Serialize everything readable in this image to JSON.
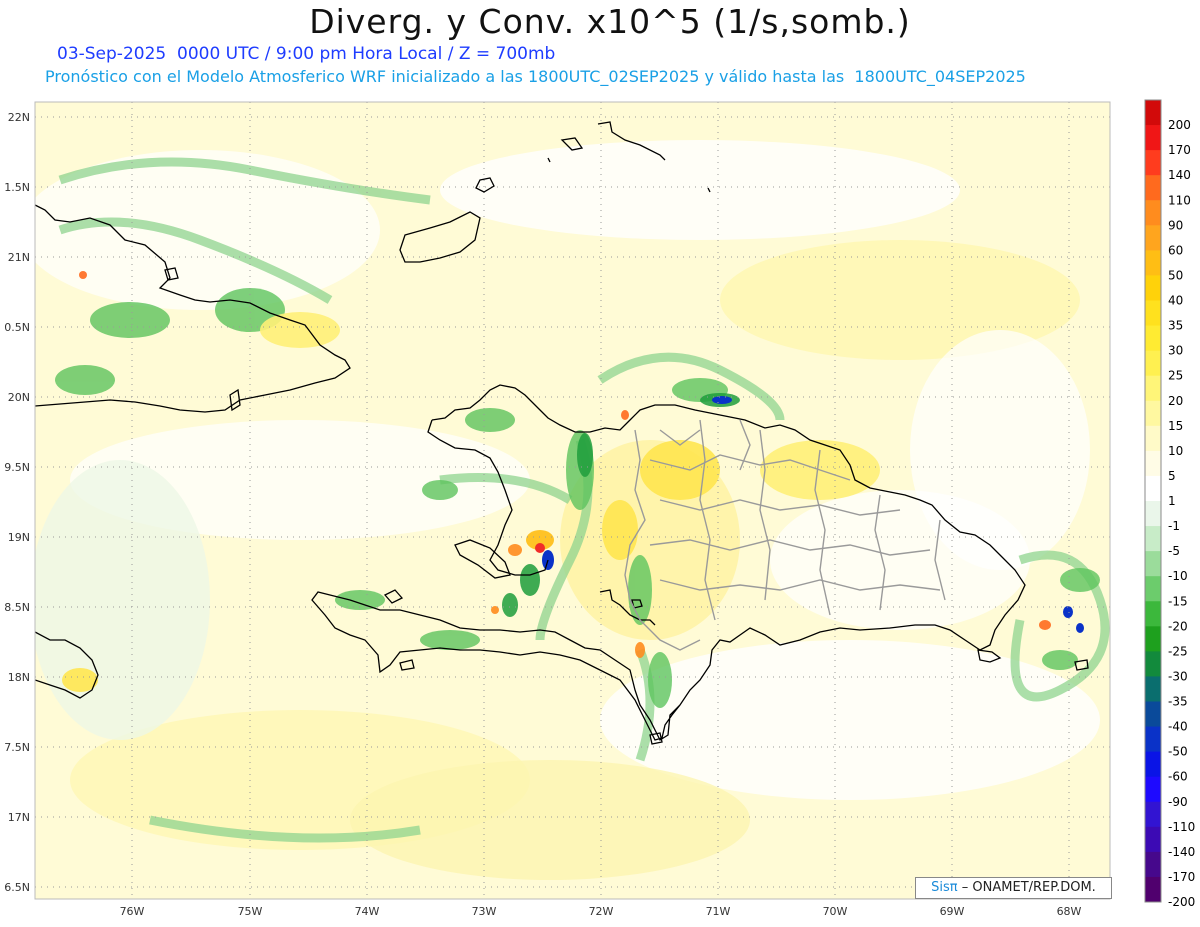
{
  "header": {
    "title": "Diverg. y Conv. x10^5 (1/s,somb.)",
    "subtitle_date": "03-Sep-2025  0000 UTC / 9:00 pm Hora Local / Z = 700mb",
    "subtitle_model": "Pronóstico con el Modelo Atmosferico WRF inicializado a las 1800UTC_02SEP2025 y válido hasta las  1800UTC_04SEP2025"
  },
  "axes": {
    "lat_labels": [
      "22N",
      "1.5N",
      "21N",
      "0.5N",
      "20N",
      "9.5N",
      "19N",
      "8.5N",
      "18N",
      "7.5N",
      "17N",
      "6.5N"
    ],
    "lon_labels": [
      "76W",
      "75W",
      "74W",
      "73W",
      "72W",
      "71W",
      "70W",
      "69W",
      "68W"
    ]
  },
  "colorbar": {
    "labels": [
      "200",
      "170",
      "140",
      "110",
      "90",
      "60",
      "50",
      "40",
      "35",
      "30",
      "25",
      "20",
      "15",
      "10",
      "5",
      "1",
      "-1",
      "-5",
      "-10",
      "-15",
      "-20",
      "-25",
      "-30",
      "-35",
      "-40",
      "-50",
      "-60",
      "-90",
      "-110",
      "-140",
      "-170",
      "-200"
    ],
    "colors": [
      "#d20a0a",
      "#f01616",
      "#ff3c1e",
      "#ff6a1e",
      "#ff8c1e",
      "#ffa51e",
      "#ffbe14",
      "#ffd20a",
      "#ffe11e",
      "#ffeb32",
      "#fff050",
      "#fff578",
      "#fff8a0",
      "#fffac8",
      "#fffce6",
      "#ffffff",
      "#eaf6ea",
      "#c8ecc8",
      "#9bdc9b",
      "#6ccc6c",
      "#3cb83c",
      "#1ea01e",
      "#128a3c",
      "#0a6e6e",
      "#0a4a9a",
      "#0a32c8",
      "#0a14e6",
      "#1e0aff",
      "#3214d2",
      "#3c0ab4",
      "#46088c",
      "#50006e"
    ]
  },
  "credit": {
    "brand": "Sisπ",
    "org": "– ONAMET/REP.DOM."
  }
}
